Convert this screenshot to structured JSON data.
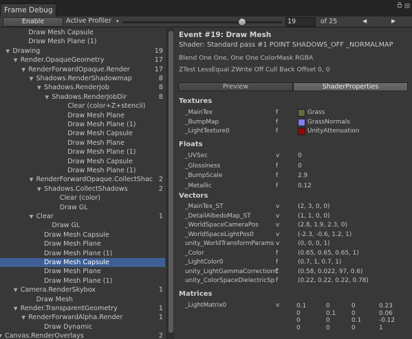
{
  "window": {
    "title": "Frame Debug"
  },
  "toolbar": {
    "enable_label": "Enable",
    "profiler_label": "Active Profiler",
    "event_index": "19",
    "of_total": "of 25",
    "prev_icon": "◀",
    "next_icon": "▶"
  },
  "tree": [
    {
      "indent": 3,
      "tri": "",
      "label": "Draw Mesh Capsule",
      "count": ""
    },
    {
      "indent": 3,
      "tri": "",
      "label": "Draw Mesh Plane (1)",
      "count": ""
    },
    {
      "indent": 1,
      "tri": "▼",
      "label": "Drawing",
      "count": "19"
    },
    {
      "indent": 2,
      "tri": "▼",
      "label": "Render.OpaqueGeometry",
      "count": "17"
    },
    {
      "indent": 3,
      "tri": "▼",
      "label": "RenderForwardOpaque.Render",
      "count": "17"
    },
    {
      "indent": 4,
      "tri": "▼",
      "label": "Shadows.RenderShadowmap",
      "count": "8"
    },
    {
      "indent": 5,
      "tri": "▼",
      "label": "Shadows.RenderJob",
      "count": "8"
    },
    {
      "indent": 6,
      "tri": "▼",
      "label": "Shadows.RenderJobDir",
      "count": "8"
    },
    {
      "indent": 8,
      "tri": "",
      "label": "Clear (color+Z+stencil)",
      "count": ""
    },
    {
      "indent": 8,
      "tri": "",
      "label": "Draw Mesh Plane",
      "count": ""
    },
    {
      "indent": 8,
      "tri": "",
      "label": "Draw Mesh Plane (1)",
      "count": ""
    },
    {
      "indent": 8,
      "tri": "",
      "label": "Draw Mesh Capsule",
      "count": ""
    },
    {
      "indent": 8,
      "tri": "",
      "label": "Draw Mesh Plane",
      "count": ""
    },
    {
      "indent": 8,
      "tri": "",
      "label": "Draw Mesh Plane (1)",
      "count": ""
    },
    {
      "indent": 8,
      "tri": "",
      "label": "Draw Mesh Capsule",
      "count": ""
    },
    {
      "indent": 8,
      "tri": "",
      "label": "Draw Mesh Plane (1)",
      "count": ""
    },
    {
      "indent": 4,
      "tri": "▼",
      "label": "RenderForwardOpaque.CollectShac",
      "count": "2"
    },
    {
      "indent": 5,
      "tri": "▼",
      "label": "Shadows.CollectShadows",
      "count": "2"
    },
    {
      "indent": 7,
      "tri": "",
      "label": "Clear (color)",
      "count": ""
    },
    {
      "indent": 7,
      "tri": "",
      "label": "Draw GL",
      "count": ""
    },
    {
      "indent": 4,
      "tri": "▼",
      "label": "Clear",
      "count": "1"
    },
    {
      "indent": 6,
      "tri": "",
      "label": "Draw GL",
      "count": ""
    },
    {
      "indent": 5,
      "tri": "",
      "label": "Draw Mesh Capsule",
      "count": ""
    },
    {
      "indent": 5,
      "tri": "",
      "label": "Draw Mesh Plane",
      "count": ""
    },
    {
      "indent": 5,
      "tri": "",
      "label": "Draw Mesh Plane (1)",
      "count": ""
    },
    {
      "indent": 5,
      "tri": "",
      "label": "Draw Mesh Capsule",
      "count": "",
      "selected": true
    },
    {
      "indent": 5,
      "tri": "",
      "label": "Draw Mesh Plane",
      "count": ""
    },
    {
      "indent": 5,
      "tri": "",
      "label": "Draw Mesh Plane (1)",
      "count": ""
    },
    {
      "indent": 2,
      "tri": "▼",
      "label": "Camera.RenderSkybox",
      "count": "1"
    },
    {
      "indent": 4,
      "tri": "",
      "label": "Draw Mesh",
      "count": ""
    },
    {
      "indent": 2,
      "tri": "▼",
      "label": "Render.TransparentGeometry",
      "count": "1"
    },
    {
      "indent": 3,
      "tri": "▼",
      "label": "RenderForwardAlpha.Render",
      "count": "1"
    },
    {
      "indent": 5,
      "tri": "",
      "label": "Draw Dynamic",
      "count": ""
    },
    {
      "indent": 0,
      "tri": "▼",
      "label": "Canvas.RenderOverlays",
      "count": "2"
    }
  ],
  "event": {
    "title": "Event #19: Draw Mesh",
    "shader": "Shader: Standard pass #1  POINT SHADOWS_OFF _NORMALMAP",
    "blend": "Blend One One, One One ColorMask RGBA",
    "ztest": "ZTest LessEqual ZWrite Off Cull Back Offset 0, 0"
  },
  "tabs": {
    "preview": "Preview",
    "shader_properties": "ShaderProperties",
    "active": "shader_properties"
  },
  "textures": {
    "header": "Textures",
    "items": [
      {
        "name": "_MainTex",
        "type": "f",
        "value": "Grass",
        "swatch": "#5f6e3a"
      },
      {
        "name": "_BumpMap",
        "type": "f",
        "value": "GrassNormals",
        "swatch": "#7f7ff5"
      },
      {
        "name": "_LightTexture0",
        "type": "f",
        "value": "UnityAttenuation",
        "swatch": "#8a0a0a"
      }
    ]
  },
  "floats": {
    "header": "Floats",
    "items": [
      {
        "name": "_UVSec",
        "type": "v",
        "value": "0"
      },
      {
        "name": "_Glossiness",
        "type": "f",
        "value": "0"
      },
      {
        "name": "_BumpScale",
        "type": "f",
        "value": "2.9"
      },
      {
        "name": "_Metallic",
        "type": "f",
        "value": "0.12"
      }
    ]
  },
  "vectors": {
    "header": "Vectors",
    "items": [
      {
        "name": "_MainTex_ST",
        "type": "v",
        "value": "(2, 3, 0, 0)"
      },
      {
        "name": "_DetailAlbedoMap_ST",
        "type": "v",
        "value": "(1, 1, 0, 0)"
      },
      {
        "name": "_WorldSpaceCameraPos",
        "type": "v",
        "value": "(2.8, 1.9, 2.3, 0)"
      },
      {
        "name": "_WorldSpaceLightPos0",
        "type": "v",
        "value": "(-2.3, -0.6, 1.2, 1)"
      },
      {
        "name": "unity_WorldTransformParams",
        "type": "v",
        "value": "(0, 0, 0, 1)"
      },
      {
        "name": "_Color",
        "type": "f",
        "value": "(0.65, 0.65, 0.65, 1)"
      },
      {
        "name": "_LightColor0",
        "type": "f",
        "value": "(0.7, 1, 0.7, 1)"
      },
      {
        "name": "unity_LightGammaCorrectionC",
        "type": "f",
        "value": "(0.58, 0.022, 97, 0.6)"
      },
      {
        "name": "unity_ColorSpaceDielectricSp",
        "type": "f",
        "value": "(0.22, 0.22, 0.22, 0.78)"
      }
    ]
  },
  "matrices": {
    "header": "Matrices",
    "items": [
      {
        "name": "_LightMatrix0",
        "type": "v",
        "rows": [
          [
            "0.1",
            "0",
            "0",
            "0.23"
          ],
          [
            "0",
            "0.1",
            "0",
            "0.06"
          ],
          [
            "0",
            "0",
            "0.1",
            "-0.12"
          ],
          [
            "0",
            "0",
            "0",
            "1"
          ]
        ]
      }
    ]
  }
}
